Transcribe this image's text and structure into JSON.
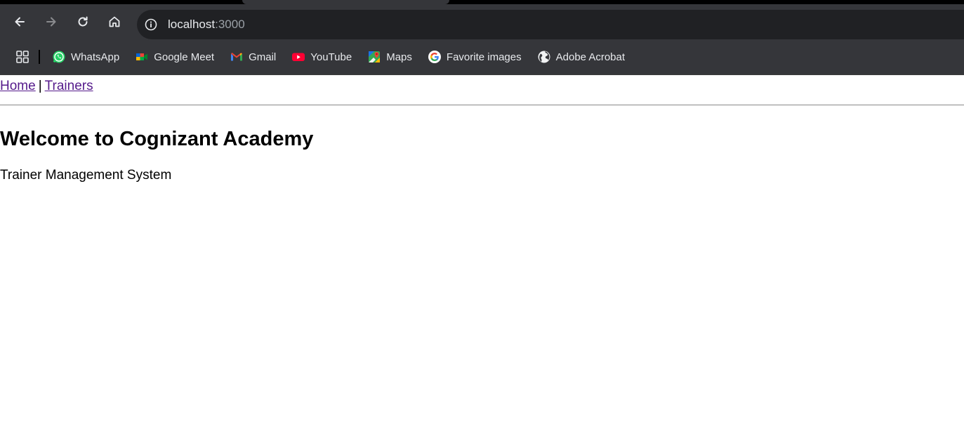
{
  "browser": {
    "url_host": "localhost",
    "url_port": ":3000",
    "nav_icons": [
      "back-arrow-icon",
      "forward-arrow-icon",
      "reload-icon",
      "home-icon"
    ],
    "bookmarks": [
      {
        "label": "WhatsApp",
        "icon": "whatsapp-icon"
      },
      {
        "label": "Google Meet",
        "icon": "google-meet-icon"
      },
      {
        "label": "Gmail",
        "icon": "gmail-icon"
      },
      {
        "label": "YouTube",
        "icon": "youtube-icon"
      },
      {
        "label": "Maps",
        "icon": "maps-icon"
      },
      {
        "label": "Favorite images",
        "icon": "google-icon"
      },
      {
        "label": "Adobe Acrobat",
        "icon": "globe-icon"
      }
    ]
  },
  "page": {
    "nav": {
      "home": "Home",
      "separator": "|",
      "trainers": "Trainers"
    },
    "title": "Welcome to Cognizant Academy",
    "subtitle": "Trainer Management System"
  },
  "colors": {
    "chrome_bg": "#35363a",
    "omnibox_bg": "#202124",
    "link_visited": "#551a8b"
  }
}
